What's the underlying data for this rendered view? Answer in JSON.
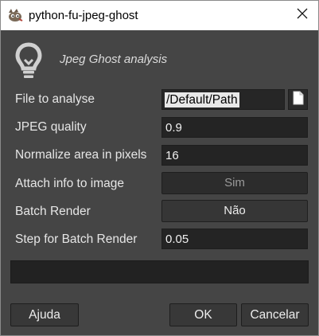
{
  "window": {
    "title": "python-fu-jpeg-ghost",
    "icon": "gimp-icon",
    "close_icon": "close-icon"
  },
  "header": {
    "icon": "lightbulb-icon",
    "text": "Jpeg Ghost analysis"
  },
  "fields": {
    "file": {
      "label": "File to analyse",
      "value": "/Default/Path",
      "button_icon": "document-icon"
    },
    "quality": {
      "label": "JPEG quality",
      "value": "0.9"
    },
    "normalize": {
      "label": "Normalize area in pixels",
      "value": "16"
    },
    "attach": {
      "label": "Attach info to image",
      "value": "Sim"
    },
    "batch": {
      "label": "Batch Render",
      "value": "Não"
    },
    "step": {
      "label": "Step for Batch Render",
      "value": "0.05"
    }
  },
  "progress": {
    "value": 0
  },
  "buttons": {
    "help": "Ajuda",
    "ok": "OK",
    "cancel": "Cancelar"
  }
}
